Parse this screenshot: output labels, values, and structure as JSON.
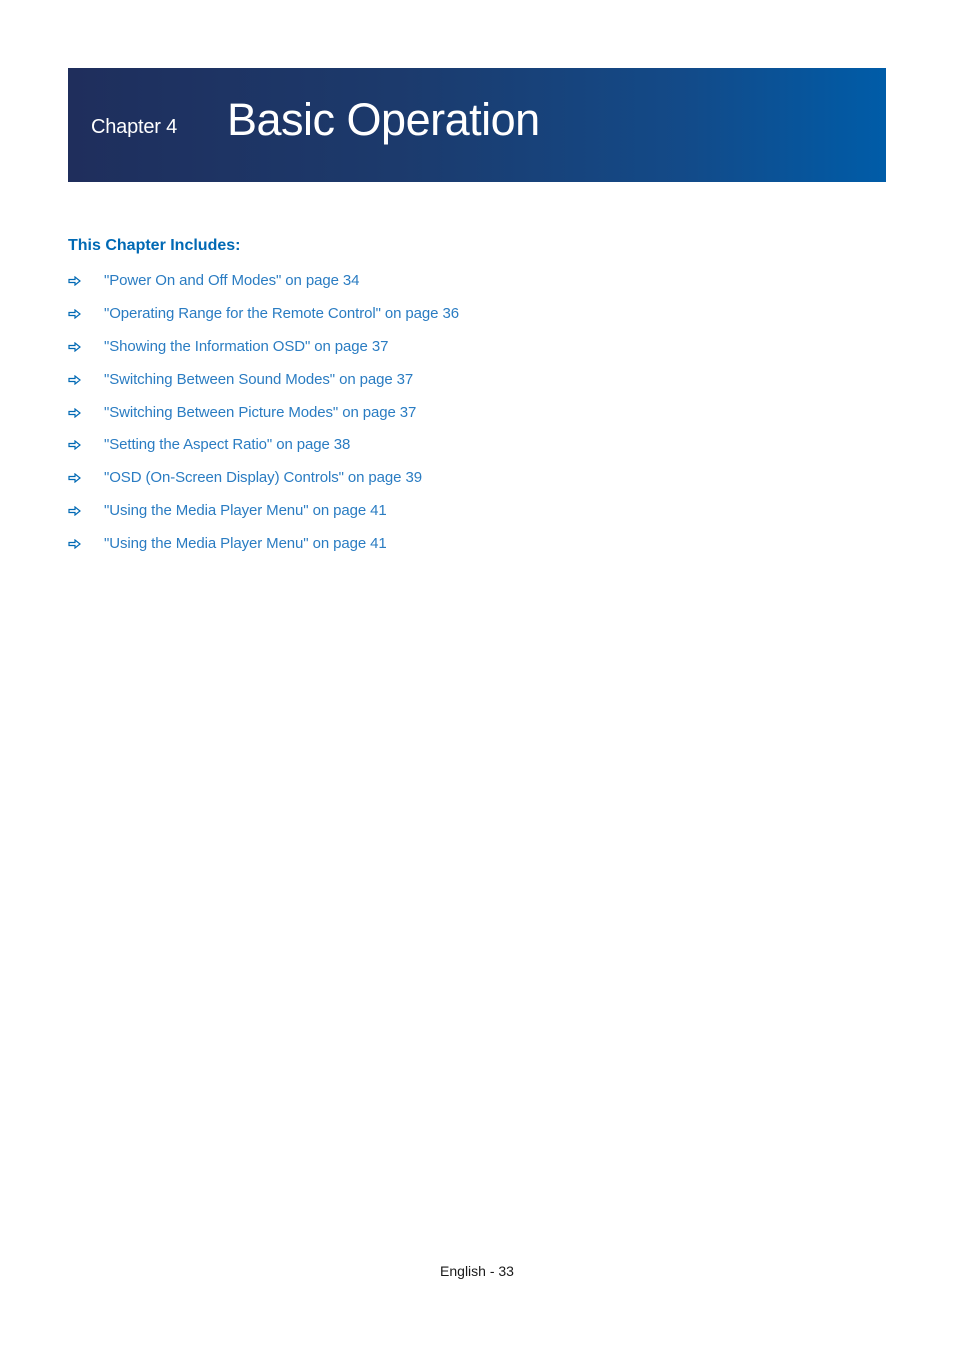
{
  "header": {
    "chapter_label": "Chapter 4",
    "chapter_title": "Basic Operation"
  },
  "includes": {
    "heading": "This Chapter Includes:",
    "items": [
      {
        "label": "\"Power On and Off Modes\" on page 34"
      },
      {
        "label": "\"Operating Range for the Remote Control\" on page 36"
      },
      {
        "label": "\"Showing the Information OSD\" on page 37"
      },
      {
        "label": "\"Switching Between Sound Modes\" on page 37"
      },
      {
        "label": "\"Switching Between Picture Modes\" on page 37"
      },
      {
        "label": "\"Setting the Aspect Ratio\" on page 38"
      },
      {
        "label": "\"OSD (On-Screen Display) Controls\" on page 39"
      },
      {
        "label": "\"Using the Media Player Menu\" on page 41"
      },
      {
        "label": "\"Using the Media Player Menu\" on page 41"
      }
    ]
  },
  "footer": {
    "page_label": "English - 33"
  },
  "colors": {
    "accent": "#0069b4",
    "link": "#2a7cc2",
    "banner_start": "#1f2e5c",
    "banner_end": "#005ca8"
  }
}
